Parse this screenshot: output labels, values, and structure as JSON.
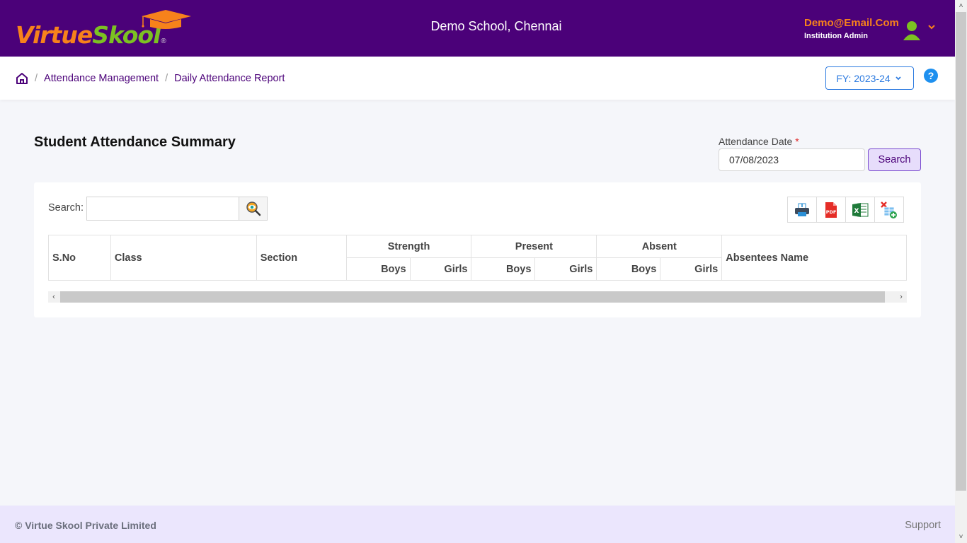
{
  "header": {
    "logo": {
      "part1": "Virtue",
      "part2": "Skool",
      "reg": "®"
    },
    "school_name": "Demo School, Chennai",
    "user": {
      "email": "Demo@Email.Com",
      "role": "Institution Admin",
      "avatar_icon": "user-avatar-icon",
      "menu_icon": "chevron-down-icon"
    }
  },
  "breadcrumb": {
    "home_icon": "home-icon",
    "separator": "/",
    "items": [
      "Attendance Management",
      "Daily Attendance Report"
    ]
  },
  "fiscal_year": {
    "label": "FY: 2023-24",
    "chevron": "⌄"
  },
  "help": {
    "glyph": "?"
  },
  "page": {
    "title": "Student Attendance Summary",
    "date_label": "Attendance Date",
    "required_marker": "*",
    "date_value": "07/08/2023",
    "search_button": "Search"
  },
  "table_tools": {
    "search_label": "Search:",
    "search_value": "",
    "search_placeholder": "",
    "exports": [
      {
        "name": "print",
        "icon": "print-icon"
      },
      {
        "name": "pdf",
        "icon": "pdf-icon",
        "text": "PDF"
      },
      {
        "name": "excel",
        "icon": "excel-icon",
        "text": "X"
      },
      {
        "name": "column-visibility",
        "icon": "column-toggle-icon"
      }
    ]
  },
  "table": {
    "columns": {
      "sno": "S.No",
      "class": "Class",
      "section": "Section",
      "strength": "Strength",
      "present": "Present",
      "absent": "Absent",
      "absentees": "Absentees Name",
      "boys": "Boys",
      "girls": "Girls"
    },
    "rows": []
  },
  "scroll": {
    "left": "‹",
    "right": "›",
    "up": "˄",
    "down": "˅"
  },
  "footer": {
    "copyright": "© Virtue Skool Private Limited",
    "support": "Support"
  },
  "colors": {
    "brand_purple": "#4b0179",
    "brand_orange": "#f7821b",
    "brand_green": "#7cc122",
    "accent_blue": "#2d7be0",
    "footer_bg": "#ebe6fd"
  }
}
